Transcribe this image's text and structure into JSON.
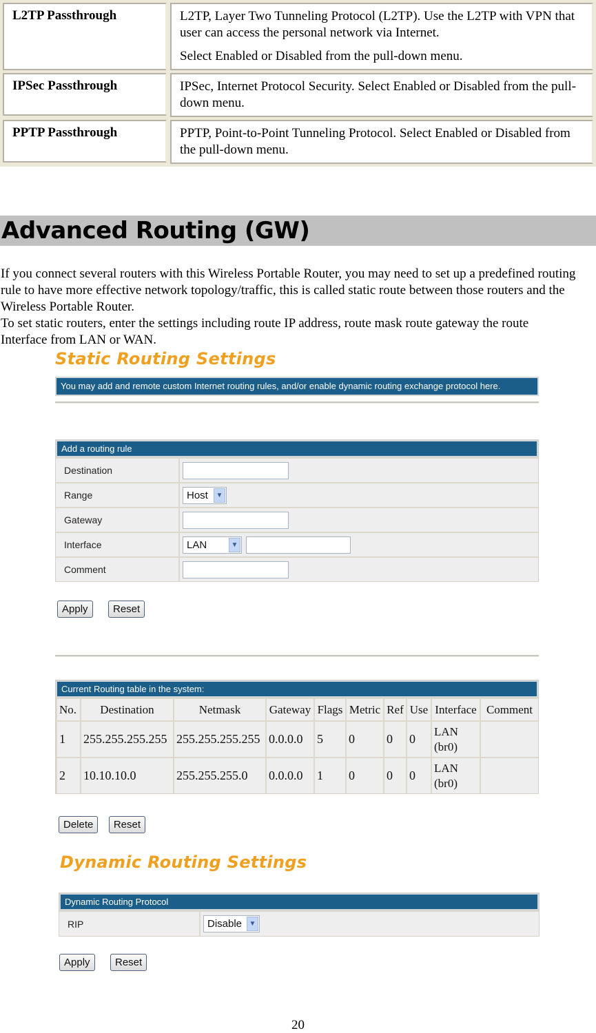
{
  "params": [
    {
      "name": "L2TP Passthrough",
      "desc": [
        "L2TP, Layer Two Tunneling Protocol (L2TP). Use the L2TP with VPN that user can access the personal network via Internet.",
        "Select Enabled or Disabled from the pull-down menu."
      ]
    },
    {
      "name": "IPSec Passthrough",
      "desc": [
        "IPSec, Internet Protocol Security. Select Enabled or Disabled from the pull-down menu."
      ]
    },
    {
      "name": "PPTP Passthrough",
      "desc": [
        "PPTP, Point-to-Point Tunneling Protocol. Select Enabled or Disabled from the pull-down menu."
      ]
    }
  ],
  "section": {
    "title": "Advanced Routing (GW)",
    "intro_1": "If you connect several routers with this Wireless Portable Router, you may need to set up a predefined routing rule to have more effective network topology/traffic, this is called static route between those routers and the Wireless Portable Router.",
    "intro_2": "To set static routers, enter the settings including route IP address, route mask route gateway the route Interface from LAN or WAN."
  },
  "static": {
    "title": "Static Routing Settings",
    "info": "You may add and remote custom Internet routing rules, and/or enable dynamic routing exchange protocol here.",
    "add_rule": {
      "header": "Add a routing rule",
      "fields": {
        "destination": {
          "label": "Destination",
          "value": ""
        },
        "range": {
          "label": "Range",
          "selected": "Host"
        },
        "gateway": {
          "label": "Gateway",
          "value": ""
        },
        "interface": {
          "label": "Interface",
          "selected": "LAN",
          "value": ""
        },
        "comment": {
          "label": "Comment",
          "value": ""
        }
      },
      "apply_label": "Apply",
      "reset_label": "Reset"
    },
    "routing_table": {
      "header": "Current Routing table in the system:",
      "columns": [
        "No.",
        "Destination",
        "Netmask",
        "Gateway",
        "Flags",
        "Metric",
        "Ref",
        "Use",
        "Interface",
        "Comment"
      ],
      "rows": [
        {
          "no": "1",
          "destination": "255.255.255.255",
          "netmask": "255.255.255.255",
          "gateway": "0.0.0.0",
          "flags": "5",
          "metric": "0",
          "ref": "0",
          "use": "0",
          "interface": "LAN",
          "interface_dev": "(br0)",
          "comment": ""
        },
        {
          "no": "2",
          "destination": "10.10.10.0",
          "netmask": "255.255.255.0",
          "gateway": "0.0.0.0",
          "flags": "1",
          "metric": "0",
          "ref": "0",
          "use": "0",
          "interface": "LAN",
          "interface_dev": "(br0)",
          "comment": ""
        }
      ],
      "delete_label": "Delete",
      "reset_label": "Reset"
    }
  },
  "dynamic": {
    "title": "Dynamic Routing Settings",
    "header": "Dynamic Routing Protocol",
    "rip_label": "RIP",
    "rip_selected": "Disable",
    "apply_label": "Apply",
    "reset_label": "Reset"
  },
  "page_number": "20",
  "colors": {
    "header_blue": "#1b5e8a",
    "title_orange": "#f0a020",
    "heading_gray": "#c0c0c0"
  }
}
